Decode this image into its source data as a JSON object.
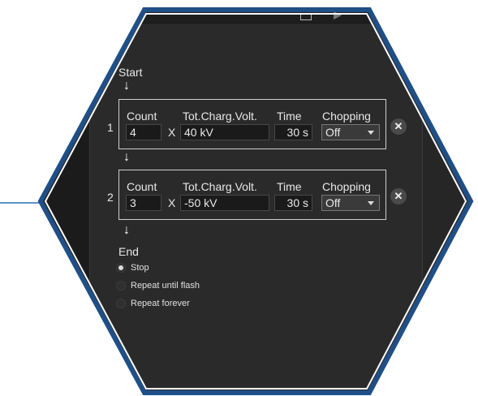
{
  "start_label": "Start",
  "end_label": "End",
  "headers": {
    "count": "Count",
    "voltage": "Tot.Charg.Volt.",
    "time": "Time",
    "chopping": "Chopping"
  },
  "multiply_sign": "X",
  "sequences": [
    {
      "index": "1",
      "count": "4",
      "voltage": "40 kV",
      "time": "30 s",
      "chopping": "Off",
      "remove_icon": "close-icon"
    },
    {
      "index": "2",
      "count": "3",
      "voltage": "-50 kV",
      "time": "30 s",
      "chopping": "Off",
      "remove_icon": "close-icon"
    }
  ],
  "end_options": [
    {
      "label": "Stop",
      "selected": true
    },
    {
      "label": "Repeat until flash",
      "selected": false
    },
    {
      "label": "Repeat forever",
      "selected": false
    }
  ],
  "colors": {
    "hex_border": "#1f4f86",
    "panel_bg": "#2a2a2a",
    "connector": "#2a6fb4"
  }
}
